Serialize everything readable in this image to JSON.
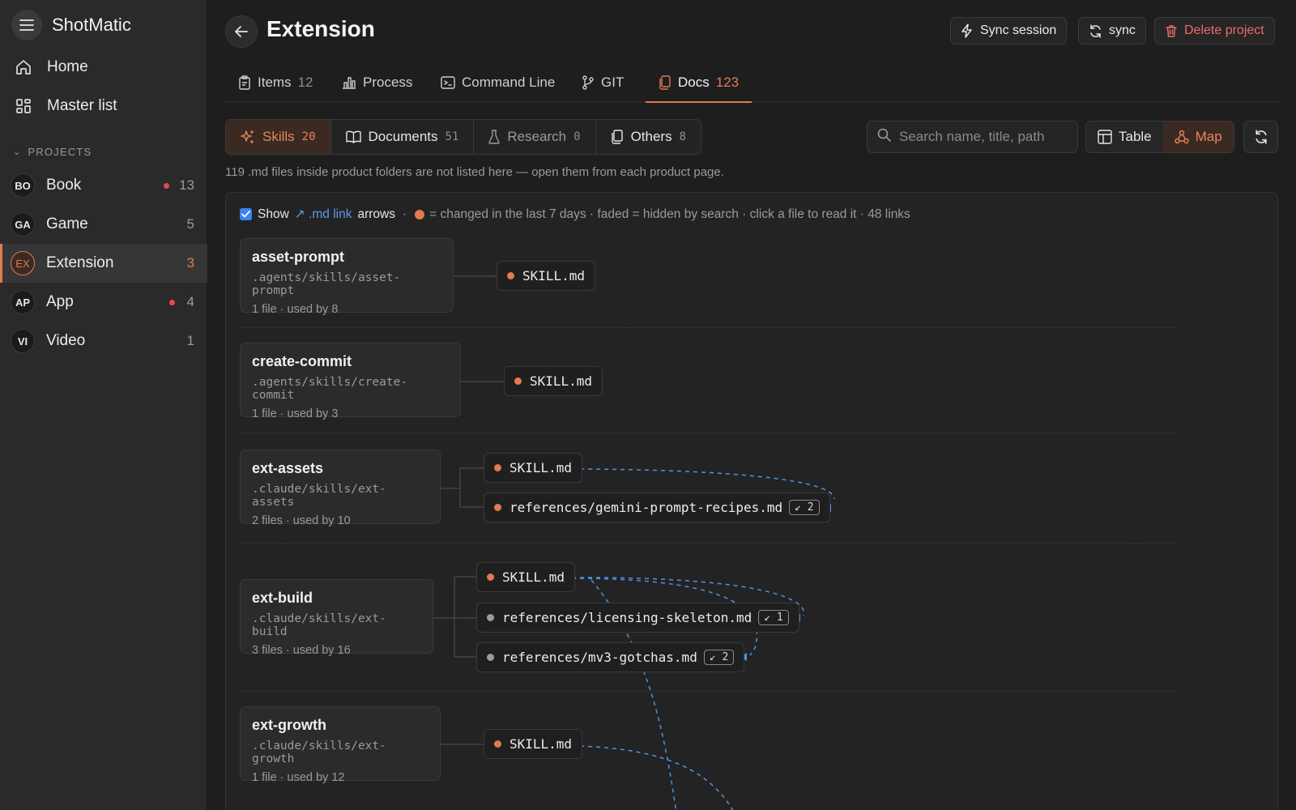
{
  "app": {
    "name": "ShotMatic"
  },
  "sidebar": {
    "nav": [
      {
        "label": "Home",
        "icon": "home-icon"
      },
      {
        "label": "Master list",
        "icon": "grid-icon"
      }
    ],
    "projects_heading": "PROJECTS",
    "projects": [
      {
        "initials": "BO",
        "name": "Book",
        "count": "13",
        "alert": true,
        "active": false
      },
      {
        "initials": "GA",
        "name": "Game",
        "count": "5",
        "alert": false,
        "active": false
      },
      {
        "initials": "EX",
        "name": "Extension",
        "count": "3",
        "alert": false,
        "active": true
      },
      {
        "initials": "AP",
        "name": "App",
        "count": "4",
        "alert": true,
        "active": false
      },
      {
        "initials": "VI",
        "name": "Video",
        "count": "1",
        "alert": false,
        "active": false
      }
    ]
  },
  "header": {
    "title": "Extension",
    "sync_session": "Sync session",
    "sync": "sync",
    "delete": "Delete project"
  },
  "tabs": [
    {
      "label": "Items",
      "count": "12",
      "icon": "clipboard-icon"
    },
    {
      "label": "Process",
      "count": "",
      "icon": "bar-chart-icon"
    },
    {
      "label": "Command Line",
      "count": "",
      "icon": "terminal-icon"
    },
    {
      "label": "GIT",
      "count": "",
      "icon": "git-branch-icon"
    },
    {
      "label": "Docs",
      "count": "123",
      "icon": "docs-icon",
      "active": true
    }
  ],
  "subtabs": [
    {
      "label": "Skills",
      "count": "20",
      "icon": "sparkles-icon",
      "active": true
    },
    {
      "label": "Documents",
      "count": "51",
      "icon": "book-icon"
    },
    {
      "label": "Research",
      "count": "0",
      "icon": "flask-icon"
    },
    {
      "label": "Others",
      "count": "8",
      "icon": "copy-icon"
    }
  ],
  "search": {
    "placeholder": "Search name, title, path",
    "value": ""
  },
  "view": {
    "table": "Table",
    "map": "Map",
    "selected": "Map"
  },
  "note": "119 .md files inside product folders are not listed here — open them from each product page.",
  "legend": {
    "show": "Show",
    "link": "↗ .md link",
    "arrows": "arrows",
    "rest": "= changed in the last 7 days · faded = hidden by search · click a file to read it  · 48 links",
    "checked": true
  },
  "skills": [
    {
      "name": "asset-prompt",
      "path": ".agents/skills/asset-prompt",
      "meta": "1 file · used by 8",
      "files": [
        {
          "name": "SKILL.md",
          "changed": true,
          "badge": ""
        }
      ]
    },
    {
      "name": "create-commit",
      "path": ".agents/skills/create-commit",
      "meta": "1 file · used by 3",
      "files": [
        {
          "name": "SKILL.md",
          "changed": true,
          "badge": ""
        }
      ]
    },
    {
      "name": "ext-assets",
      "path": ".claude/skills/ext-assets",
      "meta": "2 files · used by 10",
      "files": [
        {
          "name": "SKILL.md",
          "changed": true,
          "badge": ""
        },
        {
          "name": "references/gemini-prompt-recipes.md",
          "changed": true,
          "badge": "↙ 2"
        }
      ]
    },
    {
      "name": "ext-build",
      "path": ".claude/skills/ext-build",
      "meta": "3 files · used by 16",
      "files": [
        {
          "name": "SKILL.md",
          "changed": true,
          "badge": ""
        },
        {
          "name": "references/licensing-skeleton.md",
          "changed": false,
          "badge": "↙ 1"
        },
        {
          "name": "references/mv3-gotchas.md",
          "changed": false,
          "badge": "↙ 2"
        }
      ]
    },
    {
      "name": "ext-growth",
      "path": ".claude/skills/ext-growth",
      "meta": "1 file · used by 12",
      "files": [
        {
          "name": "SKILL.md",
          "changed": true,
          "badge": ""
        }
      ]
    }
  ],
  "colors": {
    "accent": "#e07b52",
    "link": "#5a9be8",
    "alert": "#e5484d",
    "danger": "#ee6a6a"
  }
}
